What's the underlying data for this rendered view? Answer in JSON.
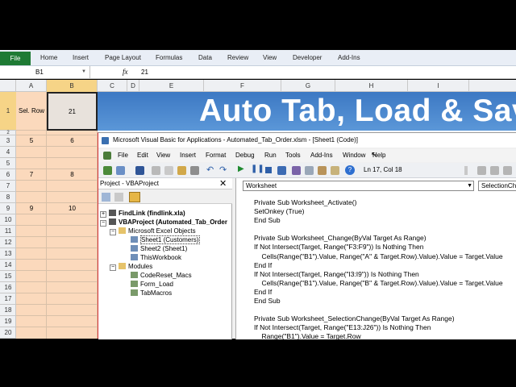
{
  "ribbon": {
    "file_label": "File",
    "tabs": [
      "Home",
      "Insert",
      "Page Layout",
      "Formulas",
      "Data",
      "Review",
      "View",
      "Developer",
      "Add-Ins"
    ]
  },
  "formula_bar": {
    "name_box": "B1",
    "fx": "fx",
    "value": "21"
  },
  "columns": [
    "A",
    "B",
    "C",
    "D",
    "E",
    "F",
    "G",
    "H",
    "I"
  ],
  "rows": [
    "1",
    "2",
    "3",
    "4",
    "5",
    "6",
    "7",
    "8",
    "9",
    "10",
    "11",
    "12",
    "13",
    "14",
    "15",
    "16",
    "17",
    "18",
    "19",
    "20"
  ],
  "cells": {
    "a1": "Sel. Row",
    "b1": "21",
    "a3": "5",
    "b3": "6",
    "a6": "7",
    "b6": "8",
    "a9": "9",
    "b9": "10"
  },
  "banner": "Auto Tab, Load & Save",
  "vba": {
    "title": "Microsoft Visual Basic for Applications - Automated_Tab_Order.xlsm - [Sheet1 (Code)]",
    "menu": [
      "File",
      "Edit",
      "View",
      "Insert",
      "Format",
      "Debug",
      "Run",
      "Tools",
      "Add-Ins",
      "Window",
      "Help"
    ],
    "position": "Ln 17, Col 18",
    "project_title": "Project - VBAProject",
    "tree": {
      "findlink": "FindLink (findlink.xla)",
      "vbaproject": "VBAProject (Automated_Tab_Order",
      "excel_objects": "Microsoft Excel Objects",
      "sheet1": "Sheet1 (Customers)",
      "sheet2": "Sheet2 (Sheet1)",
      "thisworkbook": "ThisWorkbook",
      "modules": "Modules",
      "mod1": "CodeReset_Macs",
      "mod2": "Form_Load",
      "mod3": "TabMacros"
    },
    "object_dropdown": "Worksheet",
    "proc_dropdown": "SelectionChange",
    "code": [
      "Private Sub Worksheet_Activate()",
      "SetOnkey (True)",
      "End Sub",
      "",
      "Private Sub Worksheet_Change(ByVal Target As Range)",
      "If Not Intersect(Target, Range(\"F3:F9\")) Is Nothing Then",
      "    Cells(Range(\"B1\").Value, Range(\"A\" & Target.Row).Value).Value = Target.Value",
      "End If",
      "If Not Intersect(Target, Range(\"I3:I9\")) Is Nothing Then",
      "    Cells(Range(\"B1\").Value, Range(\"B\" & Target.Row).Value).Value = Target.Value",
      "End If",
      "End Sub",
      "",
      "Private Sub Worksheet_SelectionChange(ByVal Target As Range)",
      "If Not Intersect(Target, Range(\"E13:J26\")) Is Nothing Then",
      "    Range(\"B1\").Value = Target.Row"
    ]
  }
}
